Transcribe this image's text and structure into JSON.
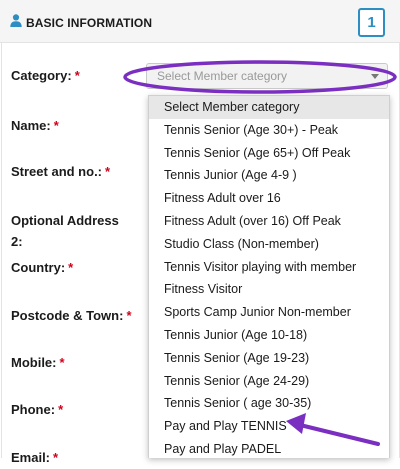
{
  "header": {
    "title": "BASIC INFORMATION",
    "step": "1",
    "accent_color": "#2d8ec4",
    "icon": "user-icon"
  },
  "form": {
    "labels": [
      {
        "id": "category",
        "text": "Category:",
        "required": "*"
      },
      {
        "id": "name",
        "text": "Name:",
        "required": "*"
      },
      {
        "id": "street",
        "text": "Street and no.:",
        "required": "*"
      },
      {
        "id": "optional-address-1",
        "text": "Optional Address",
        "required": ""
      },
      {
        "id": "optional-address-2",
        "text": "2:",
        "required": ""
      },
      {
        "id": "country",
        "text": "Country:",
        "required": "*"
      },
      {
        "id": "postcode",
        "text": "Postcode & Town:",
        "required": "*"
      },
      {
        "id": "mobile",
        "text": "Mobile:",
        "required": "*"
      },
      {
        "id": "phone",
        "text": "Phone:",
        "required": "*"
      },
      {
        "id": "email",
        "text": "Email:",
        "required": "*"
      }
    ],
    "required_color": "#d0021b"
  },
  "category_select": {
    "value": "Select Member category",
    "icon": "chevron-down-icon",
    "options": [
      "Select Member category",
      "Tennis Senior (Age 30+) - Peak",
      "Tennis Senior (Age 65+) Off Peak",
      "Tennis Junior (Age 4-9 )",
      "Fitness Adult over 16",
      "Fitness Adult (over 16) Off Peak",
      "Studio Class (Non-member)",
      "Tennis Visitor playing with member",
      "Fitness Visitor",
      "Sports Camp Junior Non-member",
      "Tennis Junior (Age 10-18)",
      "Tennis Senior (Age 19-23)",
      "Tennis Senior (Age 24-29)",
      "Tennis Senior ( age 30-35)",
      "Pay and Play TENNIS",
      "Pay and Play PADEL"
    ]
  },
  "annotations": {
    "color": "#7b2fc0"
  }
}
